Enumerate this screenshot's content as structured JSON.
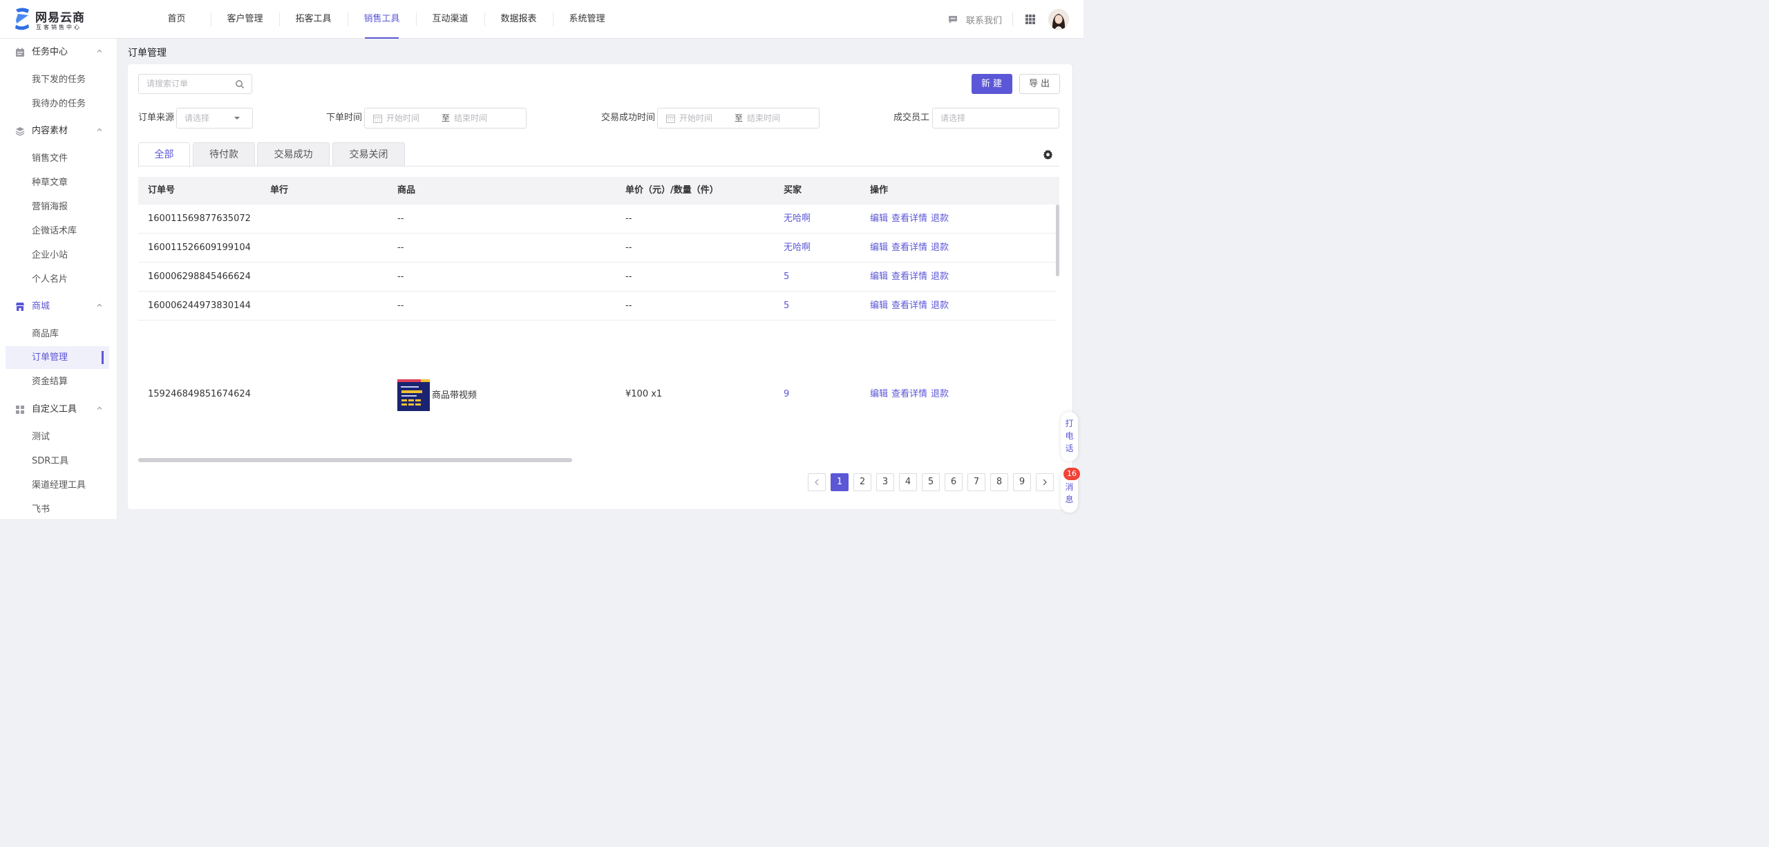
{
  "brand": {
    "name": "网易云商",
    "subtitle": "互客销售中心"
  },
  "nav": [
    "首页",
    "客户管理",
    "拓客工具",
    "销售工具",
    "互动渠道",
    "数据报表",
    "系统管理"
  ],
  "nav_active": "销售工具",
  "contact_label": "联系我们",
  "sidebar": {
    "groups": [
      {
        "label": "任务中心",
        "icon": "task-icon",
        "items": [
          "我下发的任务",
          "我待办的任务"
        ]
      },
      {
        "label": "内容素材",
        "icon": "layers-icon",
        "items": [
          "销售文件",
          "种草文章",
          "营销海报",
          "企微话术库",
          "企业小站",
          "个人名片"
        ]
      },
      {
        "label": "商城",
        "icon": "store-icon",
        "active": true,
        "items": [
          "商品库",
          "订单管理",
          "资金结算"
        ]
      },
      {
        "label": "自定义工具",
        "icon": "grid-icon",
        "items": [
          "测试",
          "SDR工具",
          "渠道经理工具",
          "飞书"
        ]
      }
    ],
    "active_item": "订单管理"
  },
  "page_title": "订单管理",
  "search_placeholder": "请搜索订单",
  "buttons": {
    "new": "新建",
    "export": "导出"
  },
  "filters": {
    "source_label": "订单来源",
    "source_placeholder": "请选择",
    "order_time_label": "下单时间",
    "success_time_label": "交易成功时间",
    "staff_label": "成交员工",
    "staff_placeholder": "请选择",
    "start_placeholder": "开始时间",
    "end_placeholder": "结束时间",
    "range_sep": "至"
  },
  "tabs": [
    "全部",
    "待付款",
    "交易成功",
    "交易关闭"
  ],
  "active_tab": "全部",
  "table": {
    "headers": [
      "订单号",
      "单行",
      "商品",
      "单价（元）/数量（件）",
      "买家",
      "操作"
    ],
    "rows": [
      {
        "order_no": "160011569877635072",
        "product": "--",
        "price": "--",
        "buyer": "无哈啊"
      },
      {
        "order_no": "160011526609199104",
        "product": "--",
        "price": "--",
        "buyer": "无哈啊"
      },
      {
        "order_no": "160006298845466624",
        "product": "--",
        "price": "--",
        "buyer": "5"
      },
      {
        "order_no": "160006244973830144",
        "product": "--",
        "price": "--",
        "buyer": "5"
      },
      {
        "order_no": "159246849851674624",
        "product": "商品带视频",
        "price": "¥100 x1",
        "buyer": "9"
      }
    ],
    "actions": [
      "编辑",
      "查看详情",
      "退款"
    ]
  },
  "pagination": {
    "pages": [
      "1",
      "2",
      "3",
      "4",
      "5",
      "6",
      "7",
      "8",
      "9"
    ],
    "current": "1"
  },
  "float": {
    "call": "打电话",
    "message": "消息",
    "message_count": "16"
  },
  "colors": {
    "accent": "#5b57d6",
    "badge": "#f04438"
  }
}
